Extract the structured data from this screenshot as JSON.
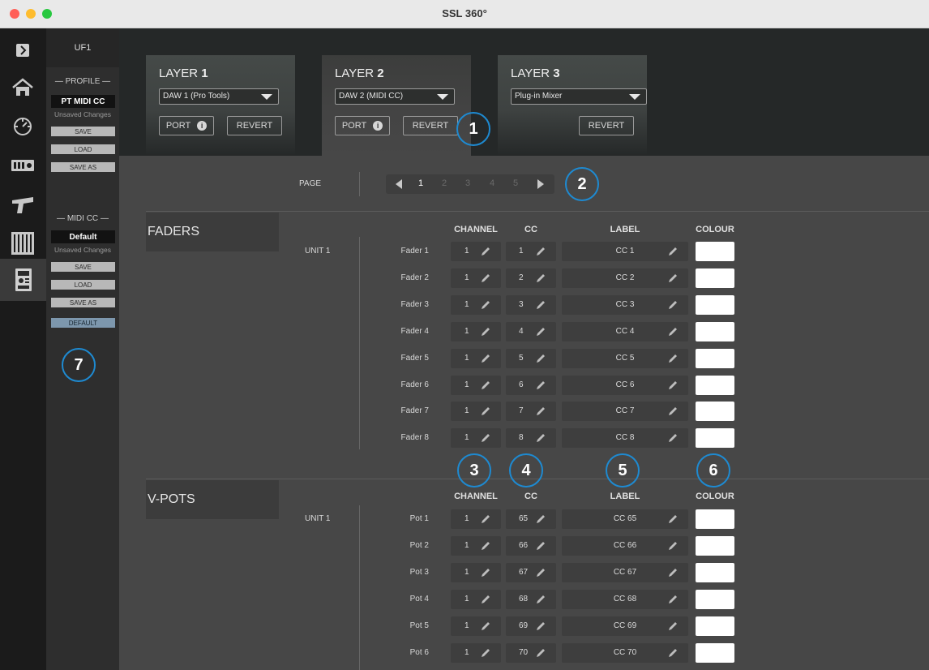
{
  "window": {
    "title": "SSL 360°"
  },
  "colors": {
    "accent_callout": "#1e8ad1",
    "swatch": "#ffffff"
  },
  "iconbar": {
    "items": [
      {
        "icon": "chevron-right-icon"
      },
      {
        "icon": "home-icon"
      },
      {
        "icon": "dial-icon"
      },
      {
        "icon": "controller-keys-icon"
      },
      {
        "icon": "channel-strip-icon"
      },
      {
        "icon": "mixer-faders-icon"
      },
      {
        "icon": "uf1-device-icon",
        "active": true
      }
    ]
  },
  "profile_panel": {
    "device": "UF1",
    "profile_section": "PROFILE",
    "profile_name": "PT MIDI CC",
    "profile_status": "Unsaved Changes",
    "profile_buttons": [
      "SAVE",
      "LOAD",
      "SAVE AS"
    ],
    "midicc_section": "MIDI CC",
    "midicc_name": "Default",
    "midicc_status": "Unsaved Changes",
    "midicc_buttons": [
      "SAVE",
      "LOAD",
      "SAVE AS"
    ],
    "default_button": "DEFAULT"
  },
  "layers": [
    {
      "prefix": "LAYER",
      "number": "1",
      "dropdown": "DAW 1 (Pro Tools)",
      "port": "PORT",
      "revert": "REVERT"
    },
    {
      "prefix": "LAYER",
      "number": "2",
      "dropdown": "DAW 2 (MIDI CC)",
      "port": "PORT",
      "revert": "REVERT",
      "active": true
    },
    {
      "prefix": "LAYER",
      "number": "3",
      "dropdown": "Plug-in Mixer",
      "revert": "REVERT"
    }
  ],
  "page": {
    "label": "PAGE",
    "pages": [
      "1",
      "2",
      "3",
      "4",
      "5"
    ],
    "current": "1"
  },
  "faders": {
    "title": "FADERS",
    "unit": "UNIT 1",
    "headers": {
      "channel": "CHANNEL",
      "cc": "CC",
      "label": "LABEL",
      "colour": "COLOUR"
    },
    "rows": [
      {
        "name": "Fader 1",
        "channel": "1",
        "cc": "1",
        "label": "CC 1"
      },
      {
        "name": "Fader 2",
        "channel": "1",
        "cc": "2",
        "label": "CC 2"
      },
      {
        "name": "Fader 3",
        "channel": "1",
        "cc": "3",
        "label": "CC 3"
      },
      {
        "name": "Fader 4",
        "channel": "1",
        "cc": "4",
        "label": "CC 4"
      },
      {
        "name": "Fader 5",
        "channel": "1",
        "cc": "5",
        "label": "CC 5"
      },
      {
        "name": "Fader 6",
        "channel": "1",
        "cc": "6",
        "label": "CC 6"
      },
      {
        "name": "Fader 7",
        "channel": "1",
        "cc": "7",
        "label": "CC 7"
      },
      {
        "name": "Fader 8",
        "channel": "1",
        "cc": "8",
        "label": "CC 8"
      }
    ]
  },
  "vpots": {
    "title": "V-POTS",
    "unit": "UNIT 1",
    "headers": {
      "channel": "CHANNEL",
      "cc": "CC",
      "label": "LABEL",
      "colour": "COLOUR"
    },
    "rows": [
      {
        "name": "Pot 1",
        "channel": "1",
        "cc": "65",
        "label": "CC 65"
      },
      {
        "name": "Pot 2",
        "channel": "1",
        "cc": "66",
        "label": "CC 66"
      },
      {
        "name": "Pot 3",
        "channel": "1",
        "cc": "67",
        "label": "CC 67"
      },
      {
        "name": "Pot 4",
        "channel": "1",
        "cc": "68",
        "label": "CC 68"
      },
      {
        "name": "Pot 5",
        "channel": "1",
        "cc": "69",
        "label": "CC 69"
      },
      {
        "name": "Pot 6",
        "channel": "1",
        "cc": "70",
        "label": "CC 70"
      }
    ]
  },
  "callouts": [
    "1",
    "2",
    "3",
    "4",
    "5",
    "6",
    "7"
  ]
}
